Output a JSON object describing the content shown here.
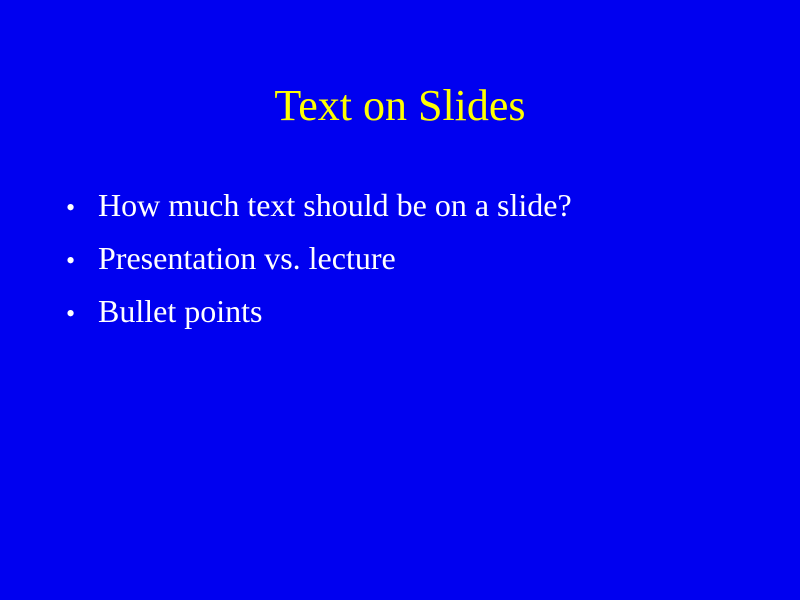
{
  "slide": {
    "title": "Text on Slides",
    "bullet_symbol": "•",
    "bullets": [
      "How much text should be on a slide?",
      "Presentation vs. lecture",
      "Bullet points"
    ]
  },
  "colors": {
    "background": "#0000F0",
    "title": "#FFFF00",
    "body_text": "#FFFFFF"
  }
}
